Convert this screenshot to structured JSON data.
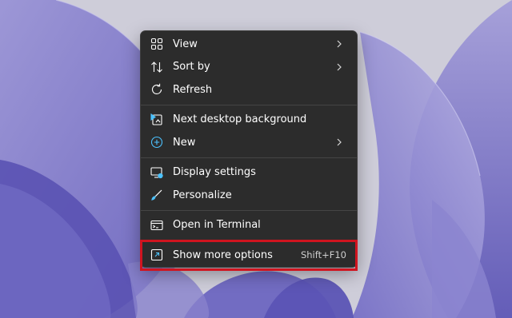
{
  "colors": {
    "menu_bg": "#2c2c2c",
    "text": "#ffffff",
    "highlight_border": "#d0141f",
    "wallpaper_accent": "#7d77c4"
  },
  "context_menu": {
    "groups": [
      [
        {
          "label": "View",
          "icon": "grid-view-icon",
          "submenu": true
        },
        {
          "label": "Sort by",
          "icon": "sort-arrows-icon",
          "submenu": true
        },
        {
          "label": "Refresh",
          "icon": "refresh-icon",
          "submenu": false
        }
      ],
      [
        {
          "label": "Next desktop background",
          "icon": "play-slideshow-icon",
          "submenu": false
        },
        {
          "label": "New",
          "icon": "add-circle-icon",
          "submenu": true
        }
      ],
      [
        {
          "label": "Display settings",
          "icon": "display-settings-icon",
          "submenu": false
        },
        {
          "label": "Personalize",
          "icon": "paint-brush-icon",
          "submenu": false
        }
      ],
      [
        {
          "label": "Open in Terminal",
          "icon": "terminal-icon",
          "submenu": false
        }
      ],
      [
        {
          "label": "Show more options",
          "icon": "expand-options-icon",
          "submenu": false,
          "shortcut": "Shift+F10",
          "highlighted": true
        }
      ]
    ]
  }
}
